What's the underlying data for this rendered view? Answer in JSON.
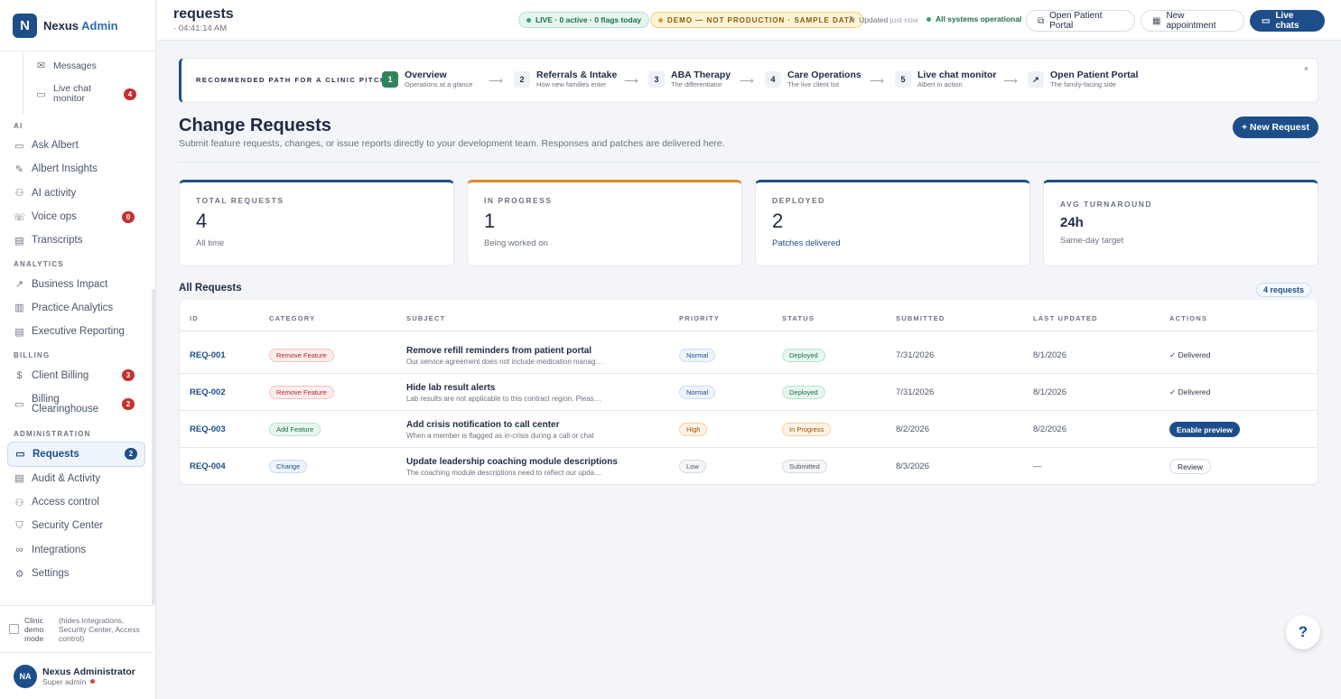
{
  "brand": {
    "logo_letter": "N",
    "name": "Nexus",
    "accent": "Admin"
  },
  "sidebar": {
    "sub_items": [
      {
        "label": "Messages",
        "icon": "mail-icon"
      },
      {
        "label": "Live chat monitor",
        "icon": "chat-icon",
        "badge": "4"
      }
    ],
    "sections": [
      {
        "label": "AI",
        "items": [
          {
            "label": "Ask Albert",
            "icon": "chat-icon"
          },
          {
            "label": "Albert Insights",
            "icon": "pen-icon"
          },
          {
            "label": "AI activity",
            "icon": "person-icon"
          },
          {
            "label": "Voice ops",
            "icon": "phone-icon",
            "badge": "0"
          },
          {
            "label": "Transcripts",
            "icon": "document-icon"
          }
        ]
      },
      {
        "label": "ANALYTICS",
        "items": [
          {
            "label": "Business Impact",
            "icon": "trend-icon"
          },
          {
            "label": "Practice Analytics",
            "icon": "bar-chart-icon"
          },
          {
            "label": "Executive Reporting",
            "icon": "document-icon"
          }
        ]
      },
      {
        "label": "BILLING",
        "items": [
          {
            "label": "Client Billing",
            "icon": "dollar-icon",
            "badge": "3"
          },
          {
            "label": "Billing Clearinghouse",
            "icon": "card-icon",
            "badge": "2"
          }
        ]
      },
      {
        "label": "ADMINISTRATION",
        "items": [
          {
            "label": "Requests",
            "icon": "chat-icon",
            "badge": "2",
            "active": true
          },
          {
            "label": "Audit & Activity",
            "icon": "document-icon"
          },
          {
            "label": "Access control",
            "icon": "person-icon"
          },
          {
            "label": "Security Center",
            "icon": "shield-icon"
          },
          {
            "label": "Integrations",
            "icon": "link-icon"
          },
          {
            "label": "Settings",
            "icon": "gear-icon"
          }
        ]
      }
    ],
    "demo_mode": {
      "label": "Clinic demo mode",
      "note": "(hides Integrations, Security Center, Access control)"
    },
    "user": {
      "initials": "NA",
      "name": "Nexus Administrator",
      "role": "Super admin"
    }
  },
  "topbar": {
    "title": "requests",
    "time": "· 04:41:14 AM",
    "live": "LIVE · 0 active · 0 flags today",
    "demo": "DEMO — NOT PRODUCTION · SAMPLE DATA",
    "updated_label": "Updated",
    "updated_value": "just now",
    "status": "All systems operational",
    "btn_portal": "Open Patient Portal",
    "btn_appointment": "New appointment",
    "btn_chats": "Live chats"
  },
  "pitch": {
    "label": "RECOMMENDED PATH FOR A CLINIC PITCH",
    "steps": [
      {
        "num": "1",
        "title": "Overview",
        "sub": "Operations at a glance"
      },
      {
        "num": "2",
        "title": "Referrals & Intake",
        "sub": "How new families enter"
      },
      {
        "num": "3",
        "title": "ABA Therapy",
        "sub": "The differentiator"
      },
      {
        "num": "4",
        "title": "Care Operations",
        "sub": "The live client list"
      },
      {
        "num": "5",
        "title": "Live chat monitor",
        "sub": "Albert in action"
      },
      {
        "num": "↗",
        "title": "Open Patient Portal",
        "sub": "The family-facing side"
      }
    ],
    "arrow": "⟶",
    "close": "×"
  },
  "page": {
    "title": "Change Requests",
    "subtitle": "Submit feature requests, changes, or issue reports directly to your development team. Responses and patches are delivered here.",
    "new_button": "+ New Request"
  },
  "stats": [
    {
      "label": "TOTAL REQUESTS",
      "value": "4",
      "note": "All time"
    },
    {
      "label": "IN PROGRESS",
      "value": "1",
      "note": "Being worked on"
    },
    {
      "label": "DEPLOYED",
      "value": "2",
      "note": "Patches delivered"
    },
    {
      "label": "AVG TURNAROUND",
      "value": "24h",
      "note": "Same-day target"
    }
  ],
  "table": {
    "title": "All Requests",
    "count": "4 requests",
    "headers": [
      "ID",
      "CATEGORY",
      "SUBJECT",
      "PRIORITY",
      "STATUS",
      "SUBMITTED",
      "LAST UPDATED",
      "ACTIONS"
    ],
    "rows": [
      {
        "id": "REQ-001",
        "category": "Remove Feature",
        "title": "Remove refill reminders from patient portal",
        "desc": "Our service agreement does not include medication management",
        "priority": "Normal",
        "status": "Deployed",
        "submitted": "7/31/2026",
        "updated": "8/1/2026",
        "action": "✓ Delivered"
      },
      {
        "id": "REQ-002",
        "category": "Remove Feature",
        "title": "Hide lab result alerts",
        "desc": "Lab results are not applicable to this contract region. Please hide",
        "priority": "Normal",
        "status": "Deployed",
        "submitted": "7/31/2026",
        "updated": "8/1/2026",
        "action": "✓ Delivered"
      },
      {
        "id": "REQ-003",
        "category": "Add Feature",
        "title": "Add crisis notification to call center",
        "desc": "When a member is flagged as in-crisis during a call or chat",
        "priority": "High",
        "status": "In Progress",
        "submitted": "8/2/2026",
        "updated": "8/2/2026",
        "action": "Enable preview"
      },
      {
        "id": "REQ-004",
        "category": "Change",
        "title": "Update leadership coaching module descriptions",
        "desc": "The coaching module descriptions need to reflect our updated",
        "priority": "Low",
        "status": "Submitted",
        "submitted": "8/3/2026",
        "updated": "—",
        "action": "Review"
      }
    ]
  },
  "help": "?"
}
